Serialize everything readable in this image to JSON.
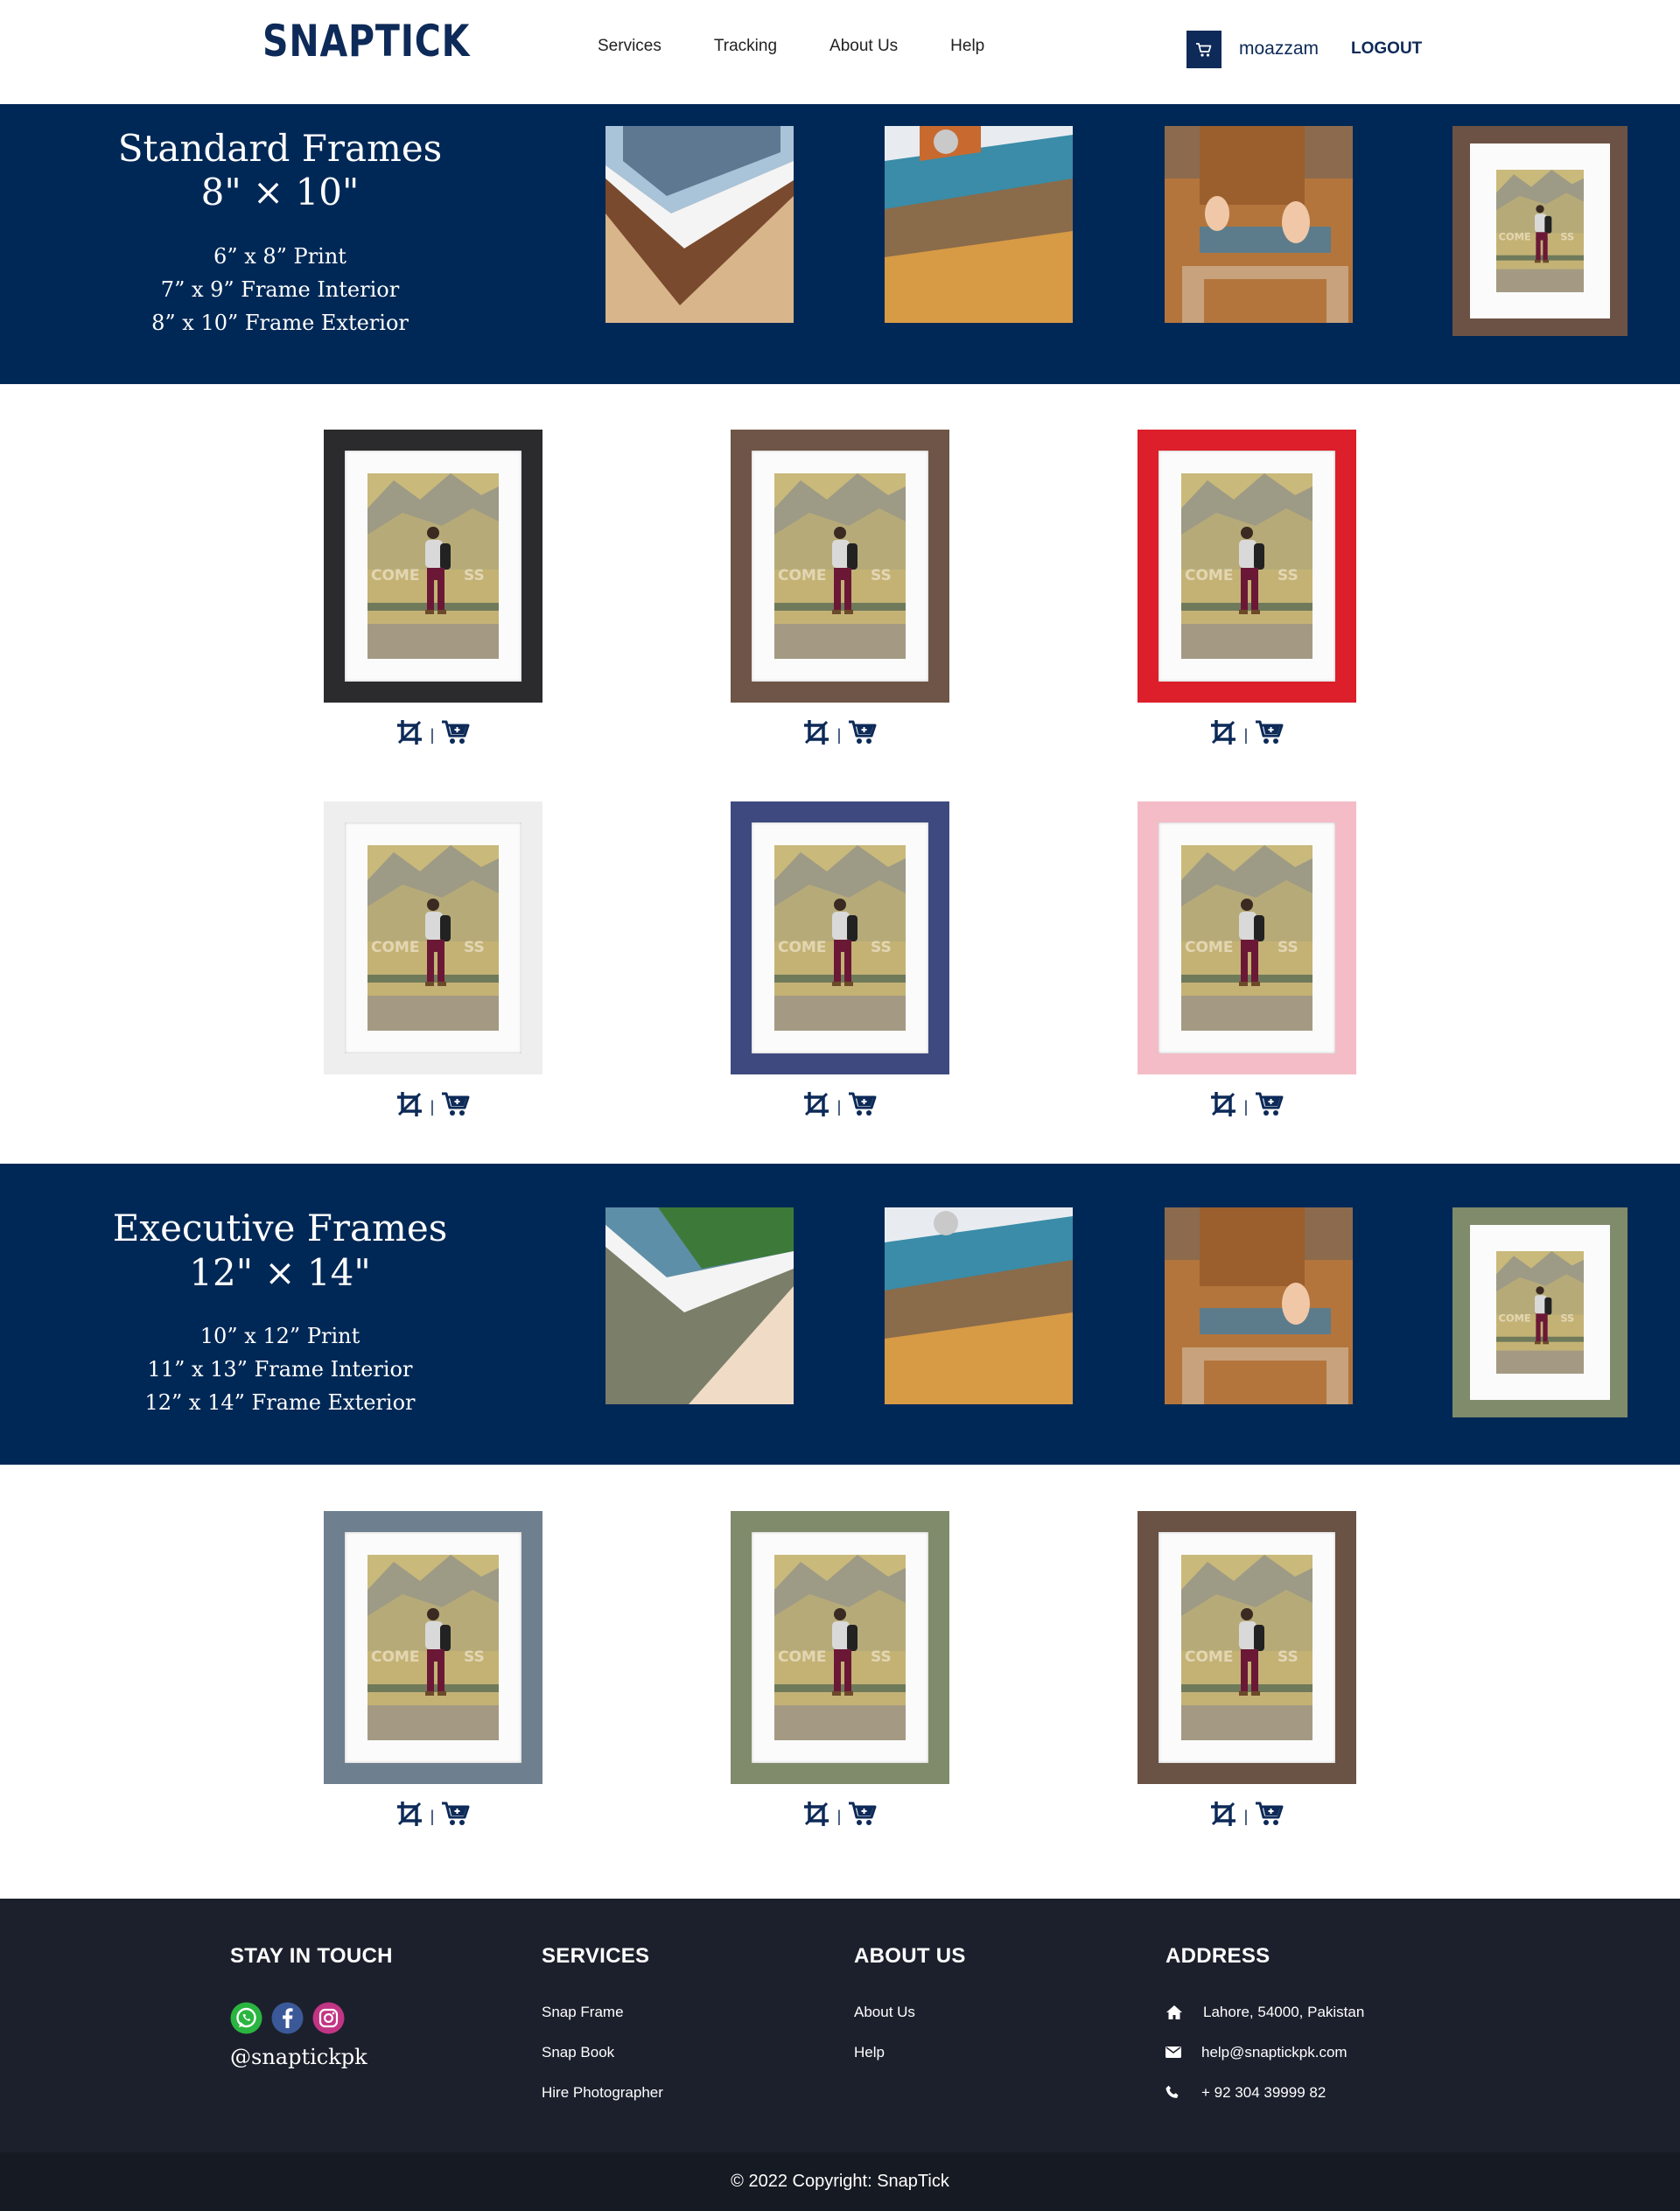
{
  "header": {
    "logo": "SNAPTICK",
    "nav": [
      "Services",
      "Tracking",
      "About Us",
      "Help"
    ],
    "username": "moazzam",
    "logout": "LOGOUT"
  },
  "standard": {
    "title": "Standard Frames",
    "size": "8\" × 10\"",
    "specs": [
      "6” x 8” Print",
      "7” x 9” Frame Interior",
      "8” x 10” Frame Exterior"
    ]
  },
  "executive": {
    "title": "Executive Frames",
    "size": "12\" × 14\"",
    "specs": [
      "10” x 12” Print",
      "11” x 13” Frame Interior",
      "12” x 14” Frame Exterior"
    ]
  },
  "actions": {
    "crop_icon": "crop-icon",
    "cart_icon": "cart-icon",
    "separator": "|"
  },
  "standard_frame_colors": [
    "#2b2b2d",
    "#6e5547",
    "#dc1f2a",
    "#eeeeee",
    "#3e4a7f",
    "#f3bcc7"
  ],
  "executive_frame_colors": [
    "#6e7f90",
    "#7f8b6a",
    "#6a5244"
  ],
  "footer": {
    "stay": {
      "heading": "STAY IN TOUCH",
      "handle": "@snaptickpk"
    },
    "services": {
      "heading": "SERVICES",
      "links": [
        "Snap Frame",
        "Snap Book",
        "Hire Photographer"
      ]
    },
    "about": {
      "heading": "ABOUT US",
      "links": [
        "About Us",
        "Help"
      ]
    },
    "address": {
      "heading": "ADDRESS",
      "location": "Lahore, 54000, Pakistan",
      "email": "help@snaptickpk.com",
      "phone": "+ 92 304 39999 82"
    },
    "copyright": "© 2022 Copyright: SnapTick"
  },
  "colors": {
    "brand": "#0d2a58",
    "banner": "#002856",
    "footer": "#1c202c"
  }
}
